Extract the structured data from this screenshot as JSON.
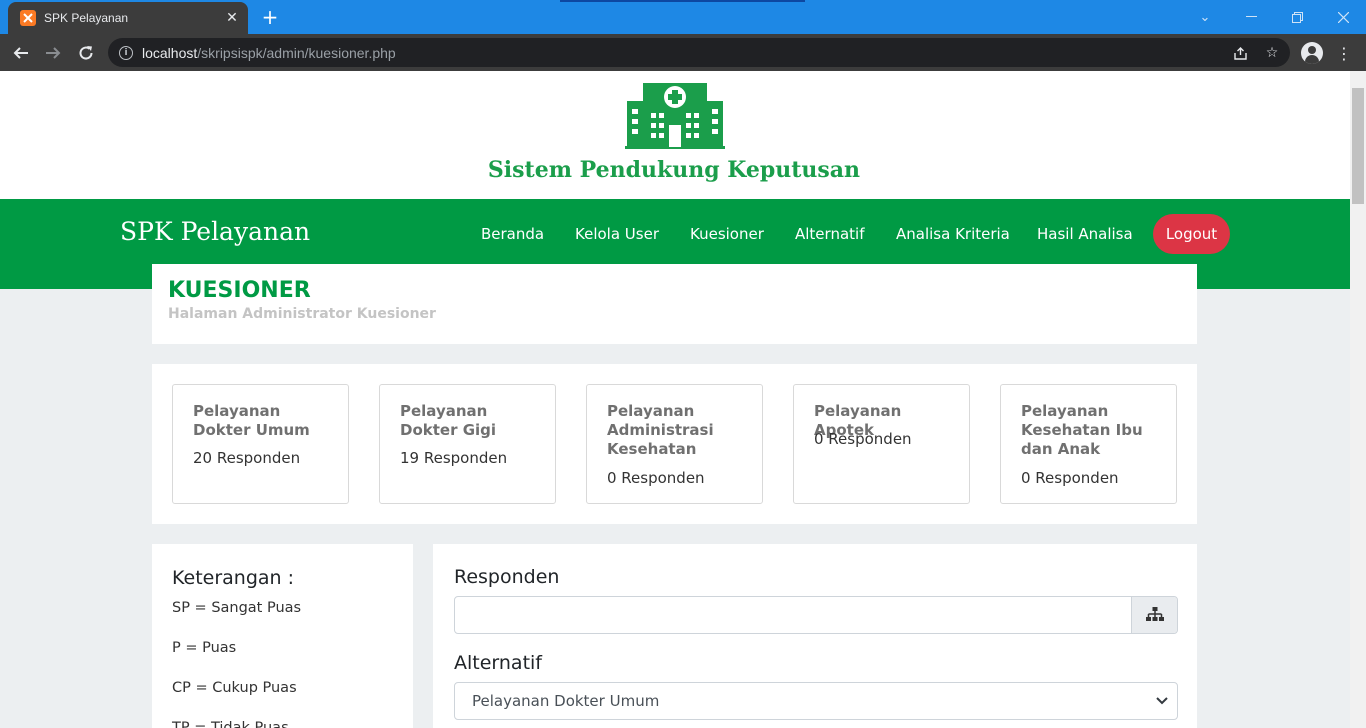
{
  "browser": {
    "tab_title": "SPK Pelayanan",
    "favicon_text": "",
    "url_host": "localhost",
    "url_path": "/skripsispk/admin/kuesioner.php"
  },
  "header": {
    "logo_text": "Sistem Pendukung Keputusan",
    "logo_color": "#1b9e4b"
  },
  "navbar": {
    "brand": "SPK Pelayanan",
    "color": "#009a44",
    "links": [
      "Beranda",
      "Kelola User",
      "Kuesioner",
      "Alternatif",
      "Analisa Kriteria",
      "Hasil Analisa"
    ],
    "logout": "Logout"
  },
  "page": {
    "title": "KUESIONER",
    "subtitle": "Halaman Administrator Kuesioner"
  },
  "stats": [
    {
      "title": "Pelayanan Dokter Umum",
      "value": "20 Responden"
    },
    {
      "title": "Pelayanan Dokter Gigi",
      "value": "19 Responden"
    },
    {
      "title": "Pelayanan Administrasi Kesehatan",
      "value": "0 Responden"
    },
    {
      "title": "Pelayanan Apotek",
      "value": "0 Responden"
    },
    {
      "title": "Pelayanan Kesehatan Ibu dan Anak",
      "value": "0 Responden"
    }
  ],
  "keterangan": {
    "title": "Keterangan :",
    "items": [
      "SP = Sangat Puas",
      "P = Puas",
      "CP = Cukup Puas",
      "TP = Tidak Puas"
    ]
  },
  "form": {
    "responden_label": "Responden",
    "responden_value": "",
    "alternatif_label": "Alternatif",
    "alternatif_selected": "Pelayanan Dokter Umum"
  }
}
